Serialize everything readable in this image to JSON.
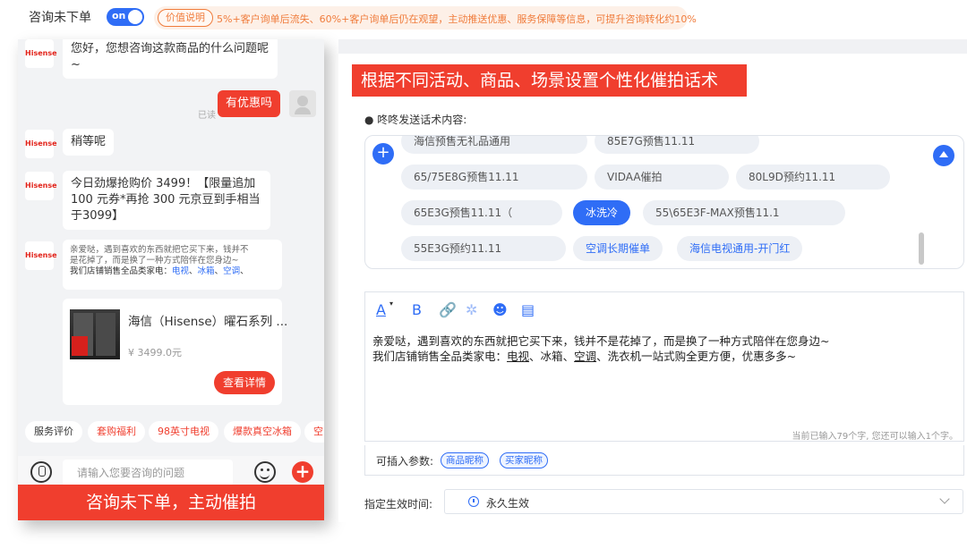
{
  "header": {
    "title": "咨询未下单",
    "toggle_label": "on",
    "value_pill": "价值说明",
    "value_desc": "5%+客户询单后流失、60%+客户询单后仍在观望，主动推送优惠、服务保障等信息，可提升咨询转化约10%"
  },
  "chat": {
    "brand_logo": "Hisense",
    "messages": [
      {
        "text": "您好，您想咨询这款商品的什么问题呢~"
      },
      {
        "text": "有优惠吗",
        "read": "已读"
      },
      {
        "text": "稍等呢"
      },
      {
        "text": "今日劲爆抢购价 3499！【限量追加100 元券*再抢 300 元京豆到手相当于3099】"
      }
    ],
    "promo_lines": [
      "亲爱哒，遇到喜欢的东西就把它买下来，钱并不",
      "是花掉了，而是换了一种方式陪伴在您身边~"
    ],
    "promo_cat_prefix": "我们店铺销售全品类家电：",
    "promo_cats": [
      "电视",
      "冰箱",
      "空调"
    ],
    "product": {
      "title": "海信（Hisense）曜石系列 ...",
      "price": "¥ 3499.0元",
      "detail_btn": "查看详情"
    },
    "quick_tags": [
      "服务评价",
      "套购福利",
      "98英寸电视",
      "爆款真空冰箱",
      "空"
    ],
    "input_placeholder": "请输入您要咨询的问题",
    "banner": "咨询未下单，主动催拍"
  },
  "panel": {
    "banner": "根据不同活动、商品、场景设置个性化催拍话术",
    "section_label": "● 咚咚发送话术内容:",
    "tags": [
      [
        "海信预售无礼品通用",
        "85E7G预售11.11"
      ],
      [
        "65/75E8G预售11.11",
        "VIDAA催拍",
        "80L9D预约11.11"
      ],
      [
        "65E3G预售11.11（",
        "冰洗冷",
        "55\\65E3F-MAX预售11.1"
      ],
      [
        "55E3G预约11.11",
        "空调长期催单",
        "海信电视通用-开门红"
      ]
    ],
    "active_tag": "冰洗冷",
    "editor_lines": [
      "亲爱哒，遇到喜欢的东西就把它买下来，钱并不是花掉了，而是换了一种方式陪伴在您身边~",
      "我们店铺销售全品类家电：电视、冰箱、空调、洗衣机一站式购全更方便，优惠多多~"
    ],
    "editor_line2": {
      "prefix": "我们店铺销售全品类家电：",
      "items": [
        "电视",
        "冰箱",
        "空调",
        "洗衣机"
      ],
      "suffix": "一站式购全更方便，优惠多多~"
    },
    "char_count": "当前已输入79个字, 您还可以输入1个字。",
    "params_label": "可插入参数:",
    "params": [
      "商品昵称",
      "买家昵称"
    ],
    "time_label": "指定生效时间:",
    "time_value": "永久生效"
  },
  "colors": {
    "accent": "#2f6df6",
    "brand_red": "#f03e2e",
    "value_orange": "#f07c3c"
  }
}
